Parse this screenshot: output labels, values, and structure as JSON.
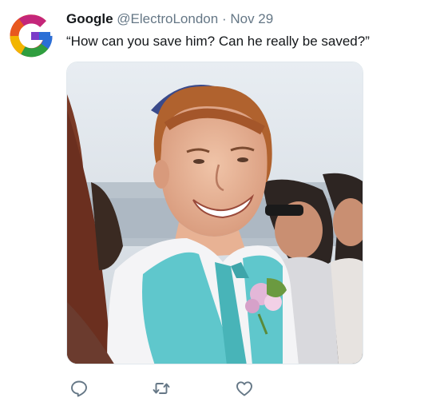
{
  "tweet": {
    "author_name": "Google",
    "handle": "@ElectroLondon",
    "separator": "·",
    "date": "Nov 29",
    "text": "“How can you save him? Can he really be saved?”"
  },
  "avatar_icon": "google-g-logo",
  "media": {
    "description_icon": "photo"
  },
  "actions": [
    {
      "icon": "reply-icon"
    },
    {
      "icon": "retweet-icon"
    },
    {
      "icon": "like-icon"
    }
  ],
  "colors": {
    "text": "#14171a",
    "secondary": "#657786",
    "border": "#e1e8ed",
    "icon": "#657786"
  }
}
